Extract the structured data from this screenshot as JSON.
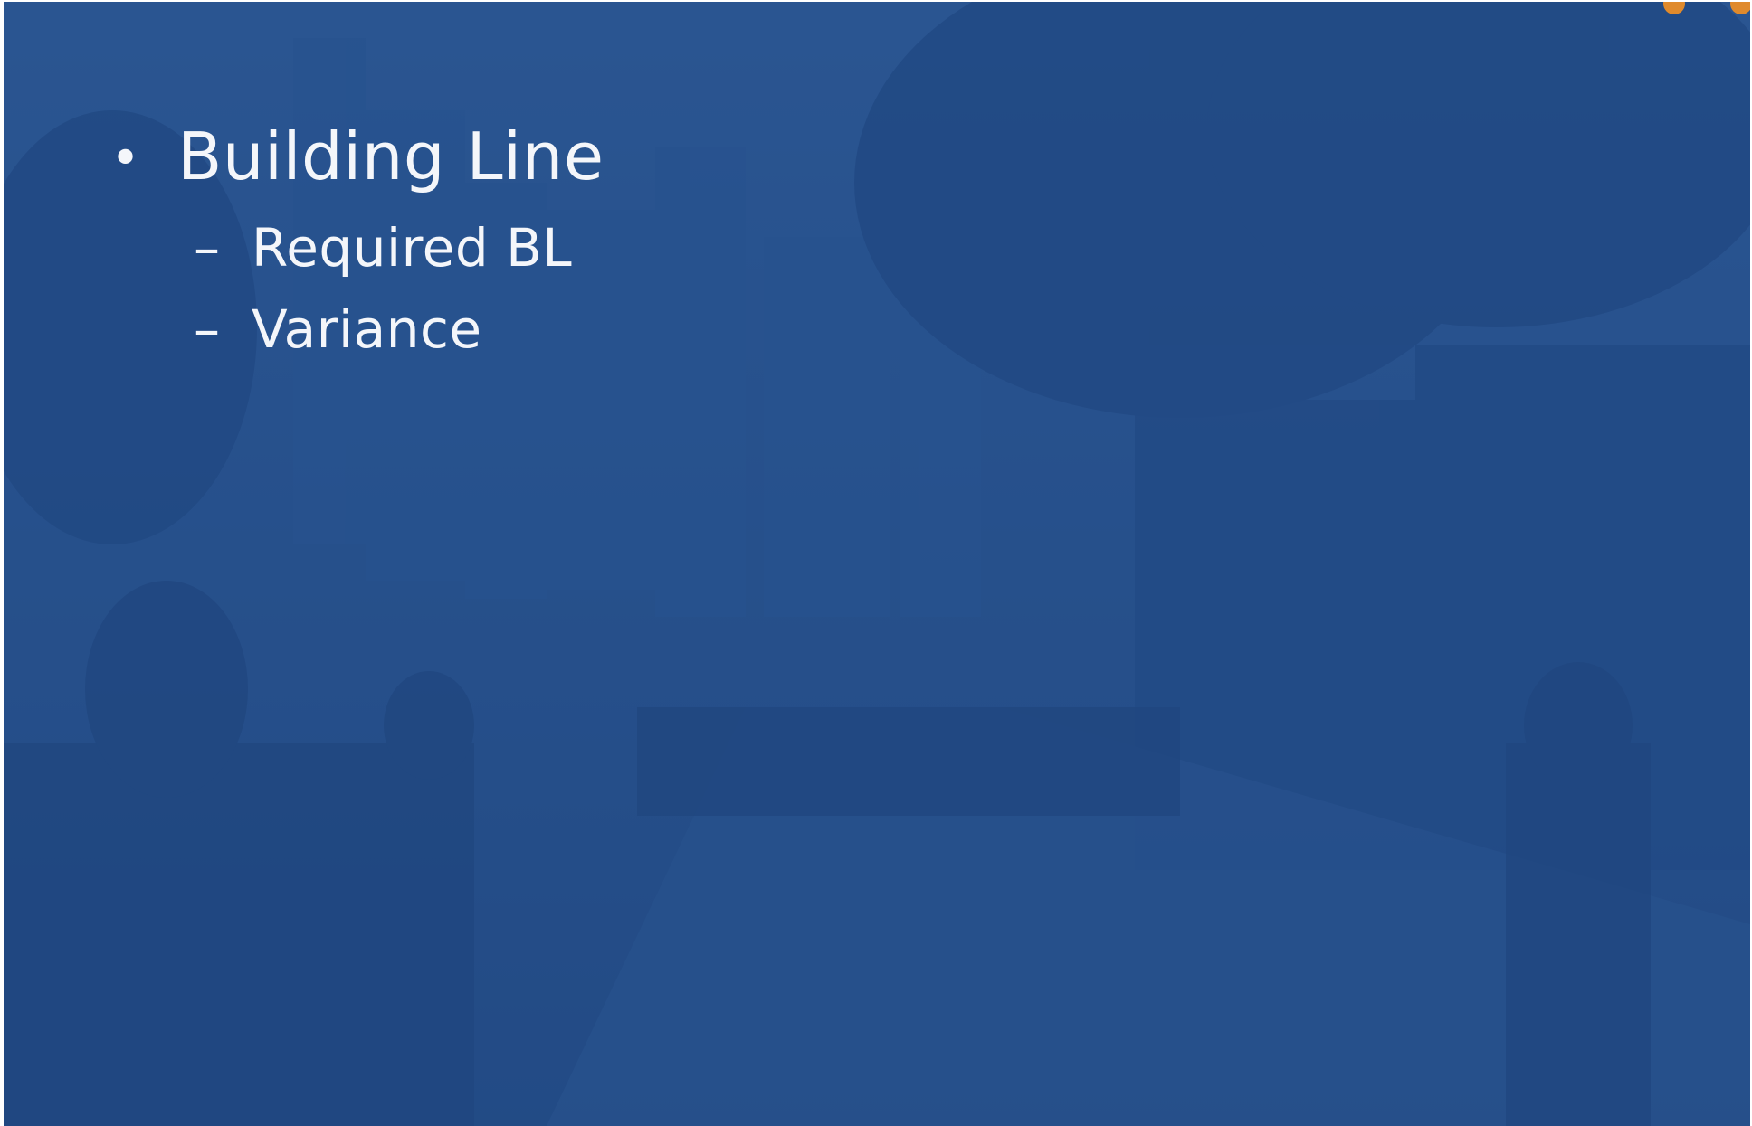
{
  "slide": {
    "bullets": [
      {
        "marker": "•",
        "text": "Building Line",
        "children": [
          {
            "marker": "–",
            "text": "Required BL"
          },
          {
            "marker": "–",
            "text": "Variance"
          }
        ]
      }
    ]
  },
  "colors": {
    "background": "#2a5287",
    "text": "#f4f6fa",
    "accent": "#e08a2c"
  }
}
